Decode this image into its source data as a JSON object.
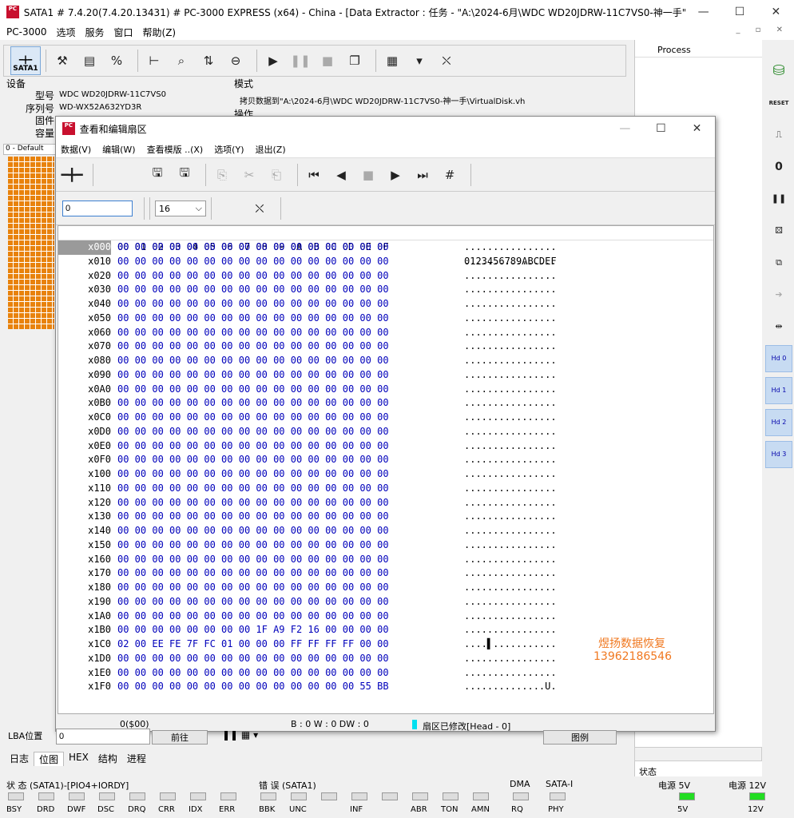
{
  "window": {
    "title": "SATA1 # 7.4.20(7.4.20.13431) # PC-3000 EXPRESS (x64) - China - [Data Extractor : 任务 - \"A:\\2024-6月\\WDC WD20JDRW-11C7VS0-神一手\"]",
    "app_icon": "PC"
  },
  "menu": {
    "items": [
      "PC-3000",
      "选项",
      "服务",
      "窗口",
      "帮助(Z)"
    ]
  },
  "toolbar": {
    "sata_label": "SATA1"
  },
  "device": {
    "section": "设备",
    "model_label": "型号",
    "model": "WDC WD20JDRW-11C7VS0",
    "serial_label": "序列号",
    "serial": "WD-WX52A632YD3R",
    "fw_label": "固件",
    "cap_label": "容量"
  },
  "mode": {
    "label": "模式",
    "value": "拷贝数据到\"A:\\2024-6月\\WDC WD20JDRW-11C7VS0-神一手\\VirtualDisk.vh",
    "op_label": "操作"
  },
  "left": {
    "default_tab": "0 - Default"
  },
  "process_pane": {
    "header": "Process",
    "tab": "状态"
  },
  "right_tools": [
    "RESET",
    "Hd 0",
    "Hd 1",
    "Hd 2",
    "Hd 3"
  ],
  "dialog": {
    "title": "查看和编辑扇区",
    "menu": [
      "数据(V)",
      "编辑(W)",
      "查看模版 ..(X)",
      "选项(Y)",
      "退出(Z)"
    ],
    "offset_value": "0",
    "cols_value": "16",
    "header_hex": "00 01 02 03 04 05 06 07 08 09 0A 0B 0C 0D 0E 0F",
    "header_ascii": "0123456789ABCDEF",
    "rows": [
      {
        "a": "x000",
        "h": "00 00 00 00 00 00 00 00 00 00 00 00 00 00 00 00",
        "t": "................"
      },
      {
        "a": "x010",
        "h": "00 00 00 00 00 00 00 00 00 00 00 00 00 00 00 00",
        "t": "................"
      },
      {
        "a": "x020",
        "h": "00 00 00 00 00 00 00 00 00 00 00 00 00 00 00 00",
        "t": "................"
      },
      {
        "a": "x030",
        "h": "00 00 00 00 00 00 00 00 00 00 00 00 00 00 00 00",
        "t": "................"
      },
      {
        "a": "x040",
        "h": "00 00 00 00 00 00 00 00 00 00 00 00 00 00 00 00",
        "t": "................"
      },
      {
        "a": "x050",
        "h": "00 00 00 00 00 00 00 00 00 00 00 00 00 00 00 00",
        "t": "................"
      },
      {
        "a": "x060",
        "h": "00 00 00 00 00 00 00 00 00 00 00 00 00 00 00 00",
        "t": "................"
      },
      {
        "a": "x070",
        "h": "00 00 00 00 00 00 00 00 00 00 00 00 00 00 00 00",
        "t": "................"
      },
      {
        "a": "x080",
        "h": "00 00 00 00 00 00 00 00 00 00 00 00 00 00 00 00",
        "t": "................"
      },
      {
        "a": "x090",
        "h": "00 00 00 00 00 00 00 00 00 00 00 00 00 00 00 00",
        "t": "................"
      },
      {
        "a": "x0A0",
        "h": "00 00 00 00 00 00 00 00 00 00 00 00 00 00 00 00",
        "t": "................"
      },
      {
        "a": "x0B0",
        "h": "00 00 00 00 00 00 00 00 00 00 00 00 00 00 00 00",
        "t": "................"
      },
      {
        "a": "x0C0",
        "h": "00 00 00 00 00 00 00 00 00 00 00 00 00 00 00 00",
        "t": "................"
      },
      {
        "a": "x0D0",
        "h": "00 00 00 00 00 00 00 00 00 00 00 00 00 00 00 00",
        "t": "................"
      },
      {
        "a": "x0E0",
        "h": "00 00 00 00 00 00 00 00 00 00 00 00 00 00 00 00",
        "t": "................"
      },
      {
        "a": "x0F0",
        "h": "00 00 00 00 00 00 00 00 00 00 00 00 00 00 00 00",
        "t": "................"
      },
      {
        "a": "x100",
        "h": "00 00 00 00 00 00 00 00 00 00 00 00 00 00 00 00",
        "t": "................"
      },
      {
        "a": "x110",
        "h": "00 00 00 00 00 00 00 00 00 00 00 00 00 00 00 00",
        "t": "................"
      },
      {
        "a": "x120",
        "h": "00 00 00 00 00 00 00 00 00 00 00 00 00 00 00 00",
        "t": "................"
      },
      {
        "a": "x130",
        "h": "00 00 00 00 00 00 00 00 00 00 00 00 00 00 00 00",
        "t": "................"
      },
      {
        "a": "x140",
        "h": "00 00 00 00 00 00 00 00 00 00 00 00 00 00 00 00",
        "t": "................"
      },
      {
        "a": "x150",
        "h": "00 00 00 00 00 00 00 00 00 00 00 00 00 00 00 00",
        "t": "................"
      },
      {
        "a": "x160",
        "h": "00 00 00 00 00 00 00 00 00 00 00 00 00 00 00 00",
        "t": "................"
      },
      {
        "a": "x170",
        "h": "00 00 00 00 00 00 00 00 00 00 00 00 00 00 00 00",
        "t": "................"
      },
      {
        "a": "x180",
        "h": "00 00 00 00 00 00 00 00 00 00 00 00 00 00 00 00",
        "t": "................"
      },
      {
        "a": "x190",
        "h": "00 00 00 00 00 00 00 00 00 00 00 00 00 00 00 00",
        "t": "................"
      },
      {
        "a": "x1A0",
        "h": "00 00 00 00 00 00 00 00 00 00 00 00 00 00 00 00",
        "t": "................"
      },
      {
        "a": "x1B0",
        "h": "00 00 00 00 00 00 00 00 1F A9 F2 16 00 00 00 00",
        "t": "................"
      },
      {
        "a": "x1C0",
        "h": "02 00 EE FE 7F FC 01 00 00 00 FF FF FF FF 00 00",
        "t": "....▌..........."
      },
      {
        "a": "x1D0",
        "h": "00 00 00 00 00 00 00 00 00 00 00 00 00 00 00 00",
        "t": "................"
      },
      {
        "a": "x1E0",
        "h": "00 00 00 00 00 00 00 00 00 00 00 00 00 00 00 00",
        "t": "................"
      },
      {
        "a": "x1F0",
        "h": "00 00 00 00 00 00 00 00 00 00 00 00 00 00 55 BB",
        "t": "..............U."
      }
    ],
    "watermark_line1": "煜扬数据恢复",
    "watermark_line2": "13962186546",
    "status_pos": "0($00)",
    "status_b": "B : 0 W : 0 DW : 0",
    "status_mod": "扇区已修改[Head - 0]"
  },
  "bottom": {
    "lba_label": "LBA位置",
    "lba_value": "0",
    "go_button": "前往",
    "legend_button": "图例",
    "tabs": [
      "日志",
      "位图",
      "HEX",
      "结构",
      "进程"
    ]
  },
  "status": {
    "group1": "状 态 (SATA1)-[PIO4+IORDY]",
    "group1_leds": [
      "BSY",
      "DRD",
      "DWF",
      "DSC",
      "DRQ",
      "CRR",
      "IDX",
      "ERR"
    ],
    "group2": "错 误 (SATA1)",
    "group2_leds": [
      "BBK",
      "UNC",
      "",
      "INF",
      "",
      "ABR",
      "TON",
      "AMN"
    ],
    "dma": "DMA",
    "dma_led": "RQ",
    "sata": "SATA-I",
    "sata_led": "PHY",
    "p5": "电源 5V",
    "p5_led": "5V",
    "p12": "电源 12V",
    "p12_led": "12V",
    "led_on_color": "#22dd22"
  }
}
